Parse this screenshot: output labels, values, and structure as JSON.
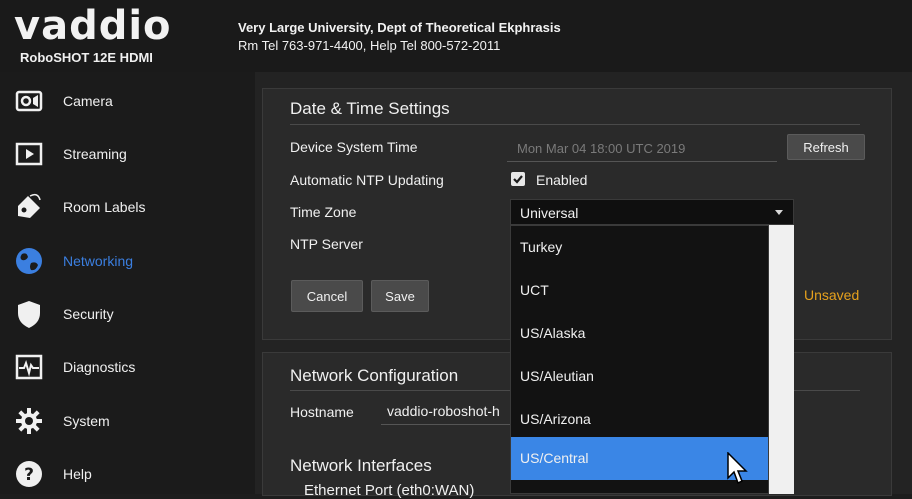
{
  "header": {
    "logo_text": "vaddio",
    "model": "RoboSHOT 12E HDMI",
    "org_line": "Very Large University, Dept of Theoretical Ekphrasis",
    "phone_line": "Rm Tel 763-971-4400, Help Tel 800-572-2011"
  },
  "sidebar": {
    "items": [
      {
        "label": "Camera",
        "icon": "camera-icon"
      },
      {
        "label": "Streaming",
        "icon": "play-icon"
      },
      {
        "label": "Room Labels",
        "icon": "tag-icon"
      },
      {
        "label": "Networking",
        "icon": "globe-icon",
        "active": true
      },
      {
        "label": "Security",
        "icon": "shield-icon"
      },
      {
        "label": "Diagnostics",
        "icon": "pulse-icon"
      },
      {
        "label": "System",
        "icon": "gear-icon"
      },
      {
        "label": "Help",
        "icon": "help-icon"
      }
    ],
    "active_color": "#3b7fe0"
  },
  "datetime": {
    "title": "Date & Time Settings",
    "system_time_label": "Device System Time",
    "system_time_value": "Mon Mar 04 18:00 UTC 2019",
    "refresh_label": "Refresh",
    "ntp_updating_label": "Automatic NTP Updating",
    "ntp_enabled_label": "Enabled",
    "ntp_enabled": true,
    "timezone_label": "Time Zone",
    "timezone_value": "Universal",
    "ntp_server_label": "NTP Server",
    "cancel_label": "Cancel",
    "save_label": "Save",
    "unsaved_label": "Unsaved",
    "unsaved_color": "#e6a11d"
  },
  "timezone_options": [
    {
      "label": "Turkey"
    },
    {
      "label": "UCT"
    },
    {
      "label": "US/Alaska"
    },
    {
      "label": "US/Aleutian"
    },
    {
      "label": "US/Arizona"
    },
    {
      "label": "US/Central",
      "highlighted": true
    }
  ],
  "network": {
    "title": "Network Configuration",
    "hostname_label": "Hostname",
    "hostname_value": "vaddio-roboshot-h",
    "interfaces_title": "Network Interfaces",
    "ethernet_label": "Ethernet Port (eth0:WAN)"
  },
  "colors": {
    "highlight": "#3a86e6"
  }
}
